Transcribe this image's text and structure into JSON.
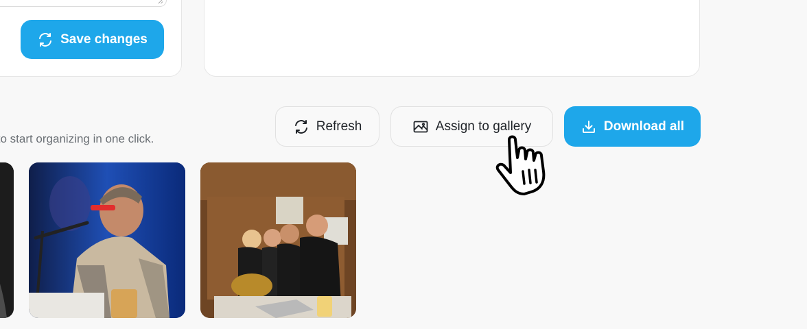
{
  "profile": {
    "save_label": "Save changes"
  },
  "gallery": {
    "helper_text": "Select photos to start organizing in one click.",
    "refresh_label": "Refresh",
    "assign_label": "Assign to gallery",
    "download_label": "Download all",
    "photos": [
      {
        "subject": "monochrome portrait (cropped)"
      },
      {
        "subject": "singer with microphone on blue stage"
      },
      {
        "subject": "four women in wooden bar"
      }
    ]
  },
  "icons": {
    "save": "refresh-icon",
    "refresh": "refresh-icon",
    "assign": "image-icon",
    "download": "download-icon",
    "cursor": "hand-pointer-icon"
  },
  "colors": {
    "accent": "#1ea7ea",
    "background": "#f8f8f8",
    "card": "#ffffff"
  }
}
